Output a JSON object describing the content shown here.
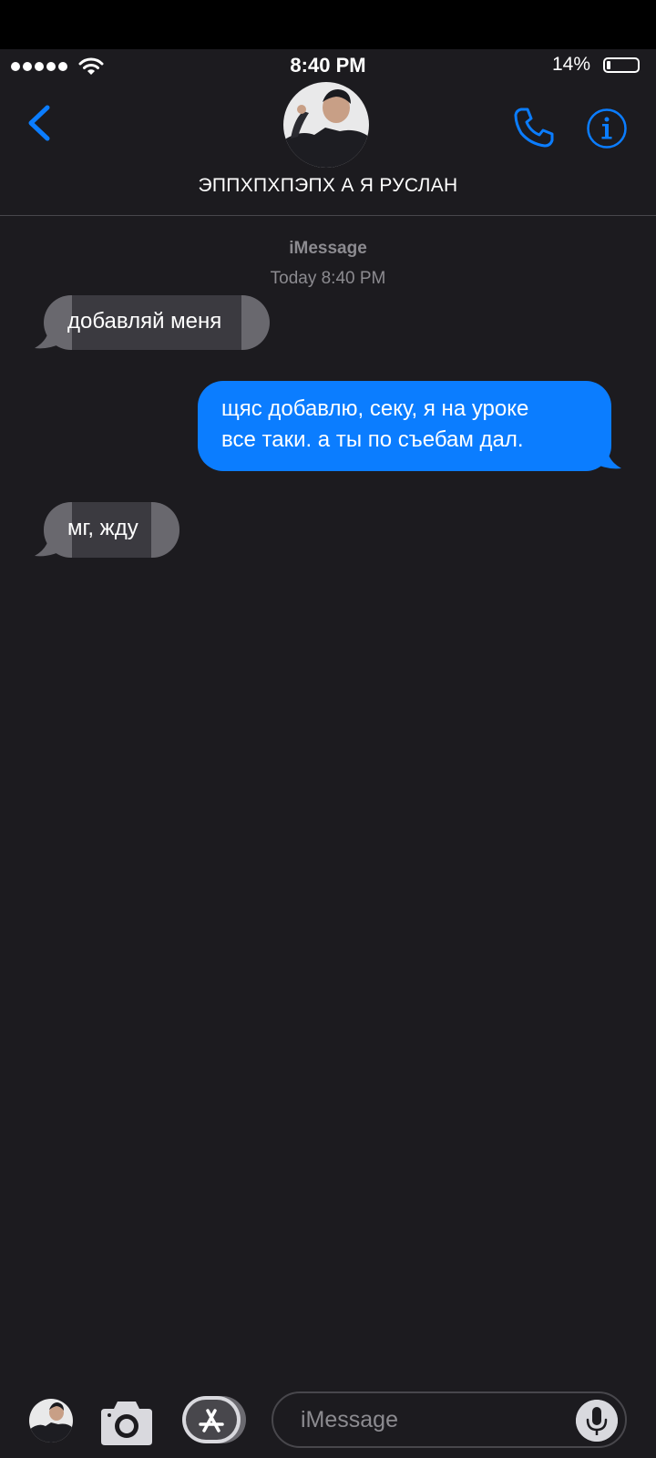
{
  "status_bar": {
    "time": "8:40 PM",
    "battery_percent": "14%",
    "battery_level": 0.14,
    "signal_bars": 5,
    "wifi_icon": "wifi-icon"
  },
  "header": {
    "contact_name": "ЭППХПХПЭПХ А Я РУСЛАН",
    "back_icon": "chevron-left-icon",
    "phone_icon": "phone-icon",
    "info_icon": "info-icon"
  },
  "conversation": {
    "service": "iMessage",
    "timestamp": "Today 8:40 PM",
    "messages": [
      {
        "direction": "incoming",
        "text": "добавляй меня"
      },
      {
        "direction": "outgoing",
        "lines": [
          "щяс добавлю, секу, я на уроке",
          "все таки. а ты по съебам дал."
        ]
      },
      {
        "direction": "incoming",
        "text": "мг, жду"
      }
    ]
  },
  "compose": {
    "placeholder": "iMessage",
    "camera_icon": "camera-icon",
    "appstore_icon": "app-store-icon",
    "mic_icon": "microphone-icon"
  },
  "colors": {
    "background": "#1c1b1f",
    "accent": "#0b7dff",
    "incoming_bubble": "#69686e",
    "secondary_text": "#8c8b90"
  }
}
